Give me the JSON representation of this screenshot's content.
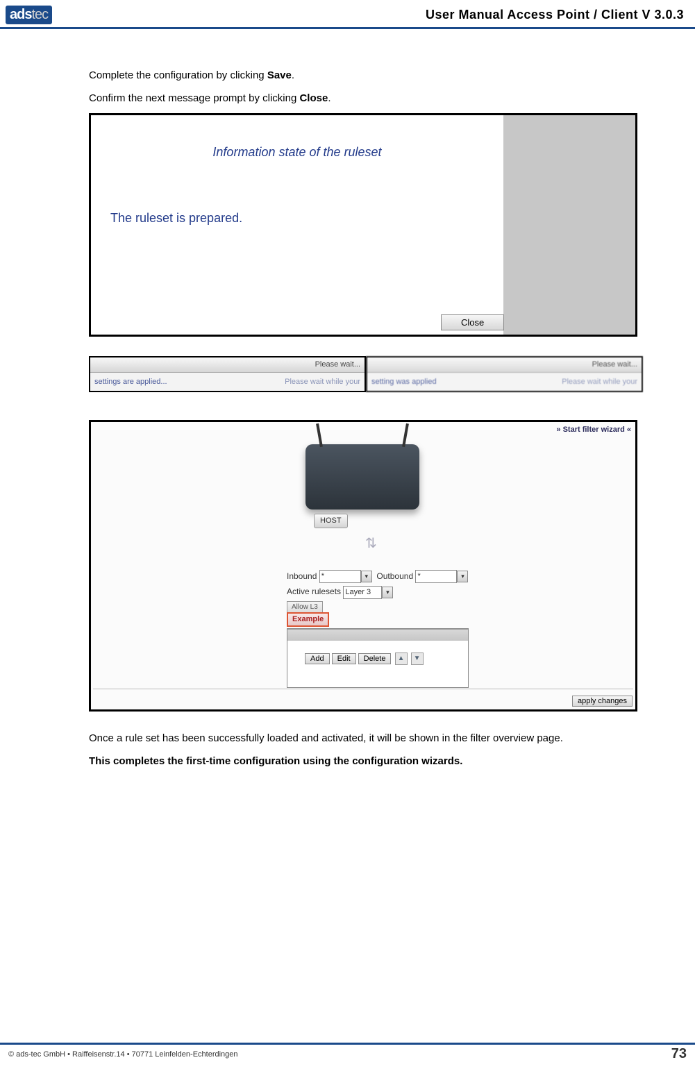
{
  "header": {
    "logo": "ads",
    "logo_suffix": "tec",
    "title": "User Manual Access  Point / Client V 3.0.3"
  },
  "intro": {
    "p1_pre": "Complete the configuration by clicking ",
    "p1_bold": "Save",
    "p1_post": ".",
    "p2_pre": "Confirm the next message prompt by clicking ",
    "p2_bold": "Close",
    "p2_post": "."
  },
  "dialog1": {
    "title": "Information state of the ruleset",
    "message": "The ruleset is prepared.",
    "close": "Close"
  },
  "waitbars": {
    "head": "Please wait...",
    "left_a": "settings are applied...",
    "left_b": "Please wait while your",
    "right_a": "setting was applied",
    "right_b": "Please wait while your"
  },
  "overview": {
    "start_wizard": "» Start filter wizard «",
    "host": "HOST",
    "inbound_label": "Inbound",
    "inbound_value": "*",
    "outbound_label": "Outbound",
    "outbound_value": "*",
    "active_label": "Active rulesets",
    "active_value": "Layer 3",
    "tab1": "Allow L3",
    "tab2": "Example",
    "btn_add": "Add",
    "btn_edit": "Edit",
    "btn_delete": "Delete",
    "apply": "apply changes"
  },
  "outro": {
    "p1": "Once a rule set has been successfully loaded and activated, it will be shown in the filter overview page.",
    "p2": "This completes the first-time configuration using the configuration wizards."
  },
  "footer": {
    "copyright": "© ads-tec GmbH • Raiffeisenstr.14 • 70771 Leinfelden-Echterdingen",
    "page": "73"
  }
}
